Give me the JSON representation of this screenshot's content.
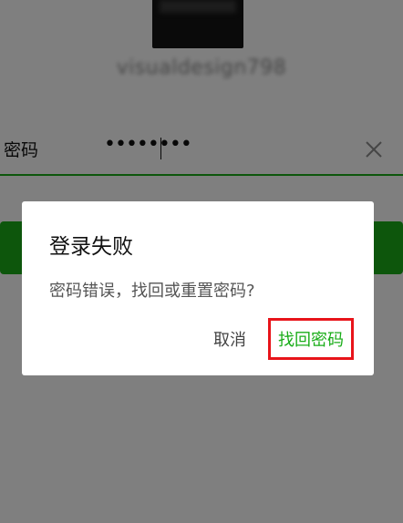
{
  "username": "visualdesign798",
  "password_field": {
    "label": "密码",
    "masked_value": "••••••••"
  },
  "icons": {
    "clear": "close-icon"
  },
  "dialog": {
    "title": "登录失败",
    "message": "密码错误，找回或重置密码?",
    "cancel_label": "取消",
    "retrieve_label": "找回密码"
  },
  "colors": {
    "accent": "#1aad19",
    "highlight": "#e8141a"
  }
}
